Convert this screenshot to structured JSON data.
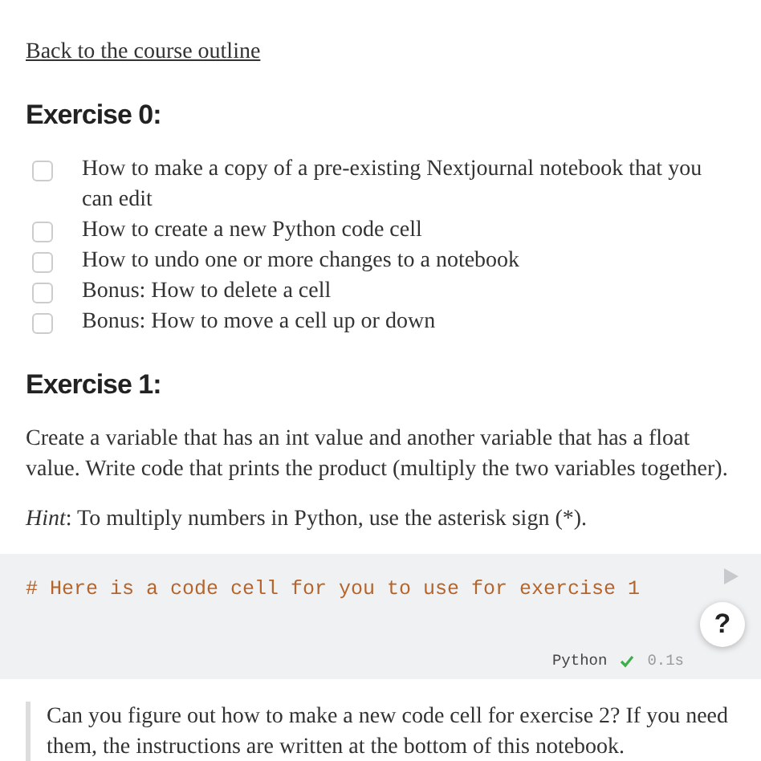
{
  "back_link": "Back to the course outline",
  "sections": [
    {
      "heading": "Exercise 0:",
      "checklist": [
        {
          "label": "How to make a copy of a pre-existing Nextjournal notebook that you can edit",
          "checked": false
        },
        {
          "label": "How to create a new Python code cell",
          "checked": false
        },
        {
          "label": "How to undo one or more changes to a notebook",
          "checked": false
        },
        {
          "label": "Bonus: How to delete a cell",
          "checked": false
        },
        {
          "label": "Bonus: How to move a cell up or down",
          "checked": false
        }
      ]
    },
    {
      "heading": "Exercise 1:",
      "paragraphs": [
        "Create a variable that has an int value and another variable that has a float value. Write code that prints the product (multiply the two variables together).",
        "*Hint*: To multiply numbers in Python, use the asterisk sign (*)."
      ]
    }
  ],
  "code_cell": {
    "code": "# Here is a code cell for you to use for exercise 1",
    "language": "Python",
    "duration": "0.1s",
    "run_ok": true
  },
  "help_button": "?",
  "quote": "Can you figure out how to make a new code cell for exercise 2? If you need them, the instructions are written at the bottom of this notebook."
}
